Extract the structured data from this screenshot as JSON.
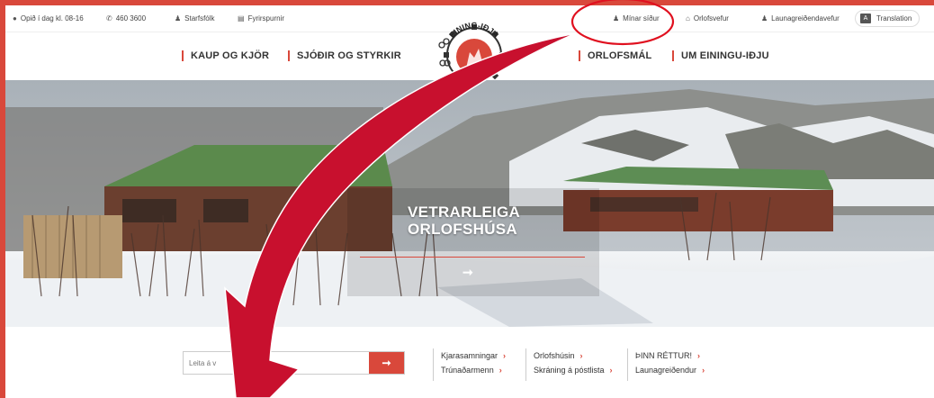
{
  "topbar": {
    "hours": "Opið í dag kl. 08-16",
    "phone": "460 3600",
    "staff": "Starfsfólk",
    "inquiries": "Fyrirspurnir",
    "my_pages": "Mínar síður",
    "holiday_web": "Orlofsvefur",
    "employer_web": "Launagreiðendavefur",
    "translation": "Translation"
  },
  "nav": {
    "items": [
      "KAUP OG KJÖR",
      "SJÓÐIR OG STYRKIR",
      "ORLOFSMÁL",
      "UM EININGU-IÐJU"
    ]
  },
  "logo": {
    "text": "EINING-IÐJA"
  },
  "hero": {
    "title_line1": "VETRARLEIGA",
    "title_line2": "ORLOFSHÚSA",
    "arrow": "➞"
  },
  "search": {
    "placeholder": "Leita á v",
    "button": "➞"
  },
  "quicklinks": {
    "col1": [
      "Kjarasamningar",
      "Trúnaðarmenn"
    ],
    "col2": [
      "Orlofshúsin",
      "Skráning á póstlista"
    ],
    "col3": [
      "ÞINN RÉTTUR!",
      "Launagreiðendur"
    ]
  },
  "colors": {
    "accent": "#d9483b",
    "annotation": "#c8102e"
  }
}
